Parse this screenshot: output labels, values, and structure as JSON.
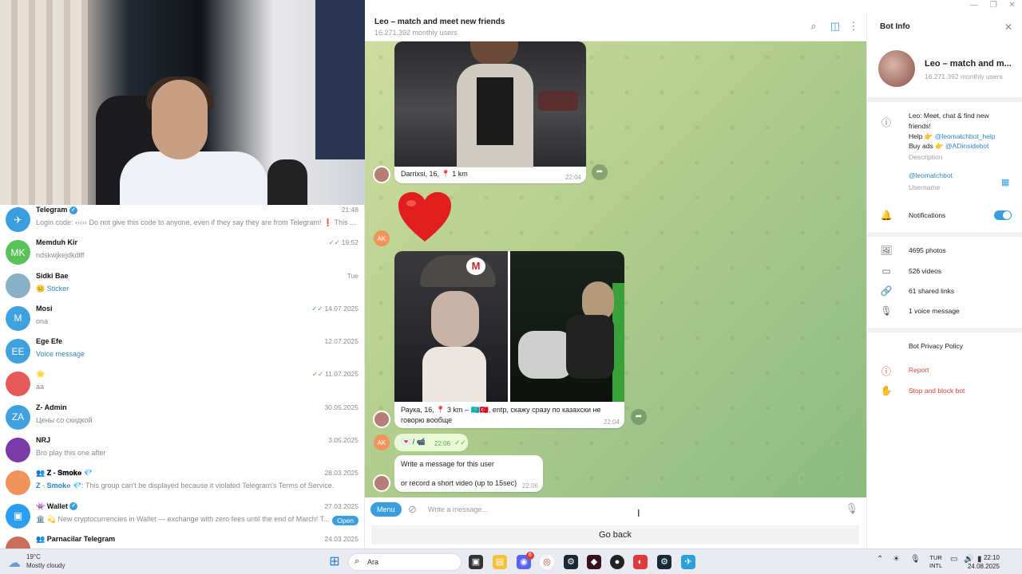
{
  "chat_header": {
    "title": "Leo – match and meet new friends",
    "subtitle": "16.271.392 monthly users"
  },
  "chat_list": [
    {
      "name": "Telegram",
      "verified": true,
      "preview": "Login code: ‹‹‹‹‹ Do not give this code to anyone, even if they say they are from Telegram! ❗ This ...",
      "time": "21:48",
      "avatar_color": "#3a9ede",
      "initials": "✈"
    },
    {
      "name": "Memduh Kir",
      "preview": "ndskwjkejdkdlff",
      "time": "19:52",
      "read": true,
      "avatar_color": "#59c35a",
      "initials": "MK"
    },
    {
      "name": "Sidki Bae",
      "preview_emoji": "😐",
      "preview": "Sticker",
      "preview_highlight": true,
      "time": "Tue",
      "avatar_color": "#8ab0c8",
      "initials": ""
    },
    {
      "name": "Mosi",
      "preview": "ona",
      "time": "14.07.2025",
      "read": true,
      "avatar_color": "#3fa1e0",
      "initials": "M"
    },
    {
      "name": "Ege Efe",
      "preview": "Voice message",
      "preview_highlight": true,
      "time": "12.07.2025",
      "avatar_color": "#3fa1e0",
      "initials": "EE"
    },
    {
      "name": "🌟",
      "preview": "aa",
      "time": "11.07.2025",
      "read": true,
      "avatar_color": "#e65a5a",
      "initials": ""
    },
    {
      "name": "Z- Admin",
      "preview": "Цены со скидкой",
      "time": "30.05.2025",
      "avatar_color": "#3fa1e0",
      "initials": "ZA"
    },
    {
      "name": "NRJ",
      "preview": "Bro play this one after",
      "time": "3.05.2025",
      "avatar_color": "#7a3aa8",
      "initials": ""
    },
    {
      "name": "👥 𝐙 - 𝐒𝐦𝐨𝐤𝐞 💎",
      "preview_prefix": "𝐙 - 𝐒𝐦𝐨𝐤𝐞 💎:",
      "preview": " This group can't be displayed because it violated Telegram's Terms of Service.",
      "time": "28.03.2025",
      "avatar_color": "#f0945c",
      "initials": ""
    },
    {
      "name": "👾 Wallet",
      "verified": true,
      "preview": "🏛️ 💫 New cryptocurrencies in Wallet — exchange with zero fees until the end of March! T...",
      "time": "27.03.2025",
      "open_label": "Open",
      "avatar_color": "#2a9ef0",
      "initials": "▣"
    },
    {
      "name": "👥 Parnacilar Telegram",
      "preview": "",
      "time": "24.03.2025",
      "avatar_color": "#c96e5c",
      "initials": ""
    }
  ],
  "messages": {
    "photo1_caption": "Darrixsi, 16, 📍 1 km",
    "photo1_time": "22:04",
    "ak_initials": "AK",
    "photo2_caption": "Раука, 16, 📍 3 km – 🇰🇿🇹🇷, entp, скажу сразу по казахски не говорю вообще",
    "photo2_time": "22:04",
    "reply_text": "💌 / 📹",
    "reply_time": "22:06",
    "bot_prompt_line1": "Write a message for this user",
    "bot_prompt_line2": "or record a short video (up to 15sec)",
    "bot_prompt_time": "22:06"
  },
  "composer": {
    "menu_label": "Menu",
    "placeholder": "Write a message...",
    "go_back": "Go back"
  },
  "bot_info": {
    "heading": "Bot Info",
    "name": "Leo – match and m...",
    "users": "16.271.392 monthly users",
    "desc_line1": "Leo: Meet, chat & find new",
    "desc_line2": "friends!",
    "help_prefix": "Help 👉 ",
    "help_link": "@leomatchbot_help",
    "ads_prefix": "Buy ads 👉 ",
    "ads_link": "@ADinsidebot",
    "desc_label": "Description",
    "username": "@leomatchbot",
    "username_label": "Username",
    "notifications": "Notifications",
    "notifications_on": true,
    "photos": "4695 photos",
    "videos": "526 videos",
    "links": "61 shared links",
    "voice": "1 voice message",
    "privacy": "Bot Privacy Policy",
    "report": "Report",
    "stop": "Stop and block bot"
  },
  "taskbar": {
    "temp": "19°C",
    "condition": "Mostly cloudy",
    "search": "Ara",
    "lang_top": "TUR",
    "lang_bottom": "INTL",
    "time": "22:10",
    "date": "24.08.2025",
    "discord_badge": "6"
  },
  "colors": {
    "accent": "#3a9ede",
    "danger": "#d6453f",
    "chat_bg": "#b5cf8e",
    "bubble_out": "#eaf8d6"
  }
}
